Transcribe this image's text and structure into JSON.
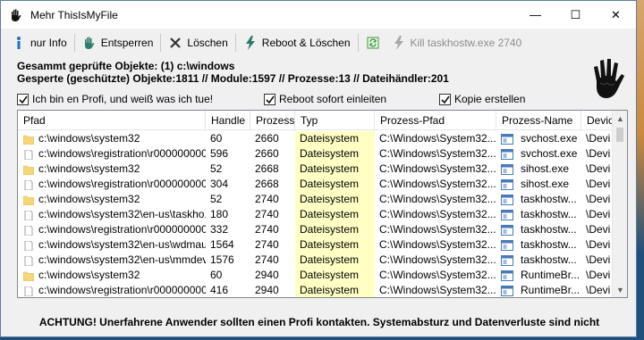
{
  "window": {
    "title": "Mehr ThisIsMyFile",
    "controls": {
      "minimize": "—",
      "maximize": "☐",
      "close": "✕"
    }
  },
  "toolbar": {
    "info": "nur Info",
    "unlock": "Entsperren",
    "delete": "Löschen",
    "reboot_delete": "Reboot & Löschen",
    "kill": "Kill taskhostw.exe 2740"
  },
  "summary": {
    "line1": "Gesammt geprüfte Objekte: (1) c:\\windows",
    "line2": "Gesperte (geschützte) Objekte:1811  //  Module:1597  //  Prozesse:13  //  Dateihändler:201"
  },
  "options": {
    "profi": {
      "label": "Ich bin en Profi, und weiß was ich tue!",
      "checked": true
    },
    "reboot": {
      "label": "Reboot sofort einleiten",
      "checked": true
    },
    "copy": {
      "label": "Kopie erstellen",
      "checked": true
    }
  },
  "list": {
    "columns": [
      "Pfad",
      "Handle",
      "Prozess",
      "Typ",
      "Prozess-Pfad",
      "Prozess-Name",
      "Devic"
    ],
    "rows": [
      {
        "folder": true,
        "path": "c:\\windows\\system32",
        "handle": "60",
        "pid": "2660",
        "type": "Dateisystem",
        "ppath": "C:\\Windows\\System32...",
        "pname": "svchost.exe",
        "device": "\\Devi"
      },
      {
        "folder": false,
        "path": "c:\\windows\\registration\\r000000000...",
        "handle": "596",
        "pid": "2660",
        "type": "Dateisystem",
        "ppath": "C:\\Windows\\System32...",
        "pname": "svchost.exe",
        "device": "\\Devi"
      },
      {
        "folder": true,
        "path": "c:\\windows\\system32",
        "handle": "52",
        "pid": "2668",
        "type": "Dateisystem",
        "ppath": "C:\\Windows\\System32...",
        "pname": "sihost.exe",
        "device": "\\Devi"
      },
      {
        "folder": false,
        "path": "c:\\windows\\registration\\r000000000...",
        "handle": "304",
        "pid": "2668",
        "type": "Dateisystem",
        "ppath": "C:\\Windows\\System32...",
        "pname": "sihost.exe",
        "device": "\\Devi"
      },
      {
        "folder": true,
        "path": "c:\\windows\\system32",
        "handle": "52",
        "pid": "2740",
        "type": "Dateisystem",
        "ppath": "C:\\Windows\\System32...",
        "pname": "taskhostw...",
        "device": "\\Devi"
      },
      {
        "folder": false,
        "path": "c:\\windows\\system32\\en-us\\taskho...",
        "handle": "180",
        "pid": "2740",
        "type": "Dateisystem",
        "ppath": "C:\\Windows\\System32...",
        "pname": "taskhostw...",
        "device": "\\Devi"
      },
      {
        "folder": false,
        "path": "c:\\windows\\registration\\r000000000...",
        "handle": "332",
        "pid": "2740",
        "type": "Dateisystem",
        "ppath": "C:\\Windows\\System32...",
        "pname": "taskhostw...",
        "device": "\\Devi"
      },
      {
        "folder": false,
        "path": "c:\\windows\\system32\\en-us\\wdmau...",
        "handle": "1564",
        "pid": "2740",
        "type": "Dateisystem",
        "ppath": "C:\\Windows\\System32...",
        "pname": "taskhostw...",
        "device": "\\Devi"
      },
      {
        "folder": false,
        "path": "c:\\windows\\system32\\en-us\\mmdev...",
        "handle": "1576",
        "pid": "2740",
        "type": "Dateisystem",
        "ppath": "C:\\Windows\\System32...",
        "pname": "taskhostw...",
        "device": "\\Devi"
      },
      {
        "folder": true,
        "path": "c:\\windows\\system32",
        "handle": "60",
        "pid": "2940",
        "type": "Dateisystem",
        "ppath": "C:\\Windows\\System32...",
        "pname": "RuntimeBr...",
        "device": "\\Devi"
      },
      {
        "folder": false,
        "path": "c:\\windows\\registration\\r000000000...",
        "handle": "416",
        "pid": "2940",
        "type": "Dateisystem",
        "ppath": "C:\\Windows\\System32...",
        "pname": "RuntimeBr...",
        "device": "\\Devi"
      }
    ]
  },
  "warning": "ACHTUNG! Unerfahrene Anwender sollten einen Profi kontakten. Systemabsturz und Datenverluste sind nicht",
  "colors": {
    "type_bg": "#ffffc4",
    "folder": "#f5d77a",
    "toolbar_disabled": "#8d8d8d"
  }
}
